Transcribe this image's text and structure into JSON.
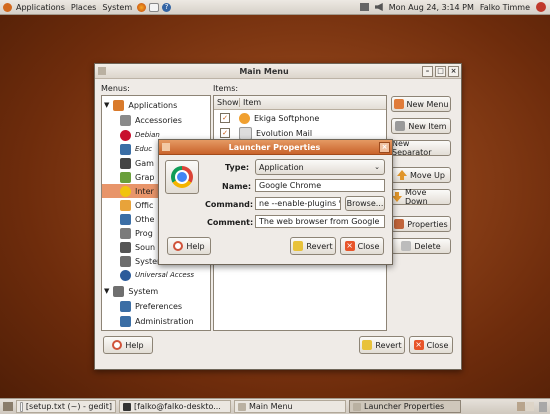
{
  "top_panel": {
    "menus": [
      "Applications",
      "Places",
      "System"
    ],
    "clock": "Mon Aug 24,  3:14 PM",
    "user": "Falko Timme"
  },
  "main_menu": {
    "title": "Main Menu",
    "menus_label": "Menus:",
    "items_label": "Items:",
    "tree": [
      {
        "label": "Applications",
        "level": 1,
        "expanded": true,
        "icon": "applications-icon"
      },
      {
        "label": "Accessories",
        "level": 2,
        "icon": "accessories-icon"
      },
      {
        "label": "Debian",
        "level": 2,
        "italic": true,
        "icon": "debian-icon"
      },
      {
        "label": "Educ",
        "level": 2,
        "italic": true,
        "icon": "education-icon"
      },
      {
        "label": "Gam",
        "level": 2,
        "icon": "games-icon"
      },
      {
        "label": "Grap",
        "level": 2,
        "icon": "graphics-icon"
      },
      {
        "label": "Inter",
        "level": 2,
        "selected": true,
        "icon": "internet-icon"
      },
      {
        "label": "Offic",
        "level": 2,
        "icon": "office-icon"
      },
      {
        "label": "Othe",
        "level": 2,
        "icon": "other-icon"
      },
      {
        "label": "Prog",
        "level": 2,
        "icon": "programming-icon"
      },
      {
        "label": "Soun",
        "level": 2,
        "icon": "sound-icon"
      },
      {
        "label": "System Tools",
        "level": 2,
        "icon": "system-tools-icon"
      },
      {
        "label": "Universal Access",
        "level": 2,
        "italic": true,
        "icon": "universal-access-icon"
      },
      {
        "label": "System",
        "level": 1,
        "expanded": true,
        "icon": "system-icon"
      },
      {
        "label": "Preferences",
        "level": 2,
        "icon": "preferences-icon"
      },
      {
        "label": "Administration",
        "level": 2,
        "icon": "administration-icon"
      }
    ],
    "items_columns": [
      "Show",
      "Item"
    ],
    "items": [
      {
        "label": "Ekiga Softphone",
        "checked": true
      },
      {
        "label": "Evolution Mail",
        "checked": true
      }
    ],
    "buttons": {
      "new_menu": "New Menu",
      "new_item": "New Item",
      "new_separator": "New Separator",
      "move_up": "Move Up",
      "move_down": "Move Down",
      "properties": "Properties",
      "delete": "Delete",
      "help": "Help",
      "revert": "Revert",
      "close": "Close"
    }
  },
  "launcher": {
    "title": "Launcher Properties",
    "type_label": "Type:",
    "type_value": "Application",
    "name_label": "Name:",
    "name_value": "Google Chrome",
    "command_label": "Command:",
    "command_value": "ne --enable-plugins %U",
    "browse": "Browse...",
    "comment_label": "Comment:",
    "comment_value": "The web browser from Google",
    "help": "Help",
    "revert": "Revert",
    "close": "Close"
  },
  "taskbar": [
    {
      "label": "[setup.txt (~) - gedit]"
    },
    {
      "label": "[falko@falko-deskto..."
    },
    {
      "label": "Main Menu"
    },
    {
      "label": "Launcher Properties",
      "active": true
    }
  ],
  "colors": {
    "accent": "#e8956a",
    "desktop": "#8a3f17",
    "close": "#e8552a"
  }
}
